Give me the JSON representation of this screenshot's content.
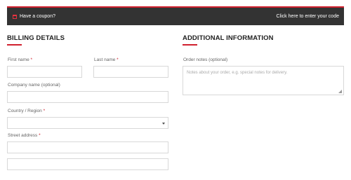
{
  "coupon": {
    "prompt": "Have a coupon?",
    "link": "Click here to enter your code",
    "accent_color": "#d0202e"
  },
  "billing": {
    "title": "BILLING DETAILS",
    "first_name_label": "First name",
    "last_name_label": "Last name",
    "company_label": "Company name (optional)",
    "country_label": "Country / Region",
    "street_label": "Street address",
    "required_marker": "*"
  },
  "additional": {
    "title": "ADDITIONAL INFORMATION",
    "order_notes_label": "Order notes (optional)",
    "order_notes_placeholder": "Notes about your order, e.g. special notes for delivery."
  },
  "icons": {
    "coupon": "calendar-icon",
    "select": "chevron-down-icon"
  }
}
